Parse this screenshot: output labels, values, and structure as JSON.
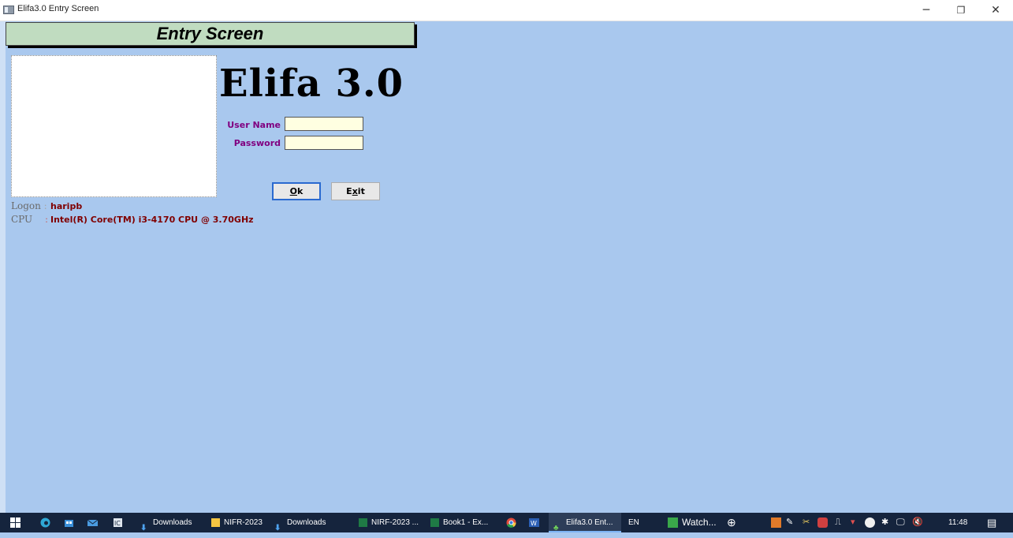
{
  "window": {
    "title": "Elifa3.0 Entry Screen",
    "minimize_glyph": "─",
    "restore_glyph": "❐",
    "close_glyph": "✕"
  },
  "header": {
    "banner": "Entry Screen"
  },
  "app_name": "Elifa 3.0",
  "login": {
    "username_label": "User Name",
    "username_value": "",
    "password_label": "Password",
    "password_value": ""
  },
  "buttons": {
    "ok_label": "Ok",
    "ok_mnemonic": "O",
    "exit_label": "Exit",
    "exit_mnemonic": "x"
  },
  "info": {
    "logon_label": "Logon",
    "logon_sep": ":",
    "logon_value": "haripb",
    "cpu_label": "CPU",
    "cpu_sep": ":",
    "cpu_value": "Intel(R) Core(TM) i3-4170 CPU @ 3.70GHz"
  },
  "taskbar": {
    "items": [
      {
        "label": "Downloads",
        "icon": "download-arrow-icon"
      },
      {
        "label": "NIFR-2023",
        "icon": "folder-icon"
      },
      {
        "label": "Downloads",
        "icon": "download-arrow-icon"
      },
      {
        "label": "NIRF-2023 ...",
        "icon": "excel-icon"
      },
      {
        "label": "Book1 - Ex...",
        "icon": "excel-icon"
      },
      {
        "label": "Elifa3.0 Ent...",
        "icon": "tree-icon"
      },
      {
        "label": "EN",
        "icon": ""
      },
      {
        "label": "Watch...",
        "icon": "watch-icon"
      }
    ],
    "clock": "11:48"
  },
  "colors": {
    "background": "#a9c8ee",
    "banner": "#c0dcc0",
    "label_purple": "#800080",
    "value_maroon": "#800000",
    "input_bg": "#ffffe1",
    "taskbar": "#15243d"
  }
}
